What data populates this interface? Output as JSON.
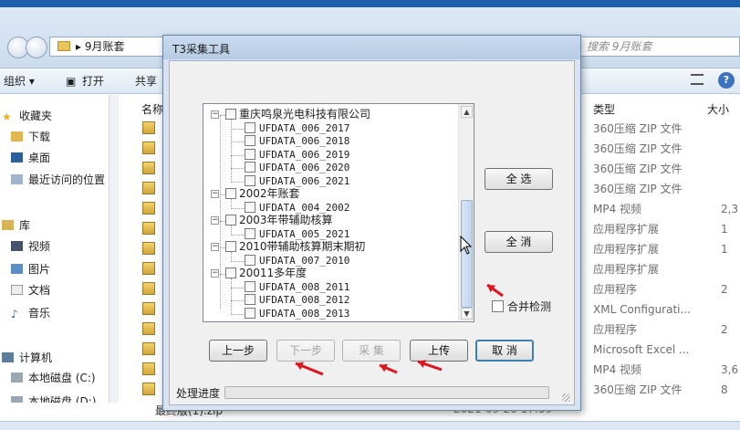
{
  "explorer": {
    "breadcrumb": "9月账套",
    "search_placeholder": "搜索 9月账套",
    "toolbar": {
      "organize": "组织 ▾",
      "open": "打开",
      "share": "共享"
    },
    "sidebar": [
      {
        "label": "收藏夹",
        "icon": "star-icon"
      },
      {
        "label": "下载",
        "icon": "download-folder-icon"
      },
      {
        "label": "桌面",
        "icon": "desktop-icon"
      },
      {
        "label": "最近访问的位置",
        "icon": "recent-places-icon"
      },
      {
        "label": "库",
        "icon": "library-icon"
      },
      {
        "label": "视频",
        "icon": "video-icon"
      },
      {
        "label": "图片",
        "icon": "pictures-icon"
      },
      {
        "label": "文档",
        "icon": "documents-icon"
      },
      {
        "label": "音乐",
        "icon": "music-icon"
      },
      {
        "label": "计算机",
        "icon": "computer-icon"
      },
      {
        "label": "本地磁盘 (C:)",
        "icon": "drive-icon"
      },
      {
        "label": "本地磁盘 (D:)",
        "icon": "drive-icon"
      }
    ],
    "columns": {
      "name": "名称",
      "type": "类型",
      "size": "大小"
    },
    "files": [
      {
        "type": "360压缩 ZIP 文件",
        "size": ""
      },
      {
        "type": "360压缩 ZIP 文件",
        "size": ""
      },
      {
        "type": "360压缩 ZIP 文件",
        "size": ""
      },
      {
        "type": "360压缩 ZIP 文件",
        "size": ""
      },
      {
        "type": "MP4 视频",
        "size": "2,3"
      },
      {
        "type": "应用程序扩展",
        "size": "1"
      },
      {
        "type": "应用程序扩展",
        "size": "1"
      },
      {
        "type": "应用程序扩展",
        "size": ""
      },
      {
        "type": "应用程序",
        "size": "2"
      },
      {
        "type": "XML Configurati...",
        "size": ""
      },
      {
        "type": "应用程序",
        "size": "2"
      },
      {
        "type": "Microsoft Excel ...",
        "size": ""
      },
      {
        "type": "MP4 视频",
        "size": "3,6"
      },
      {
        "type": "360压缩 ZIP 文件",
        "size": "8"
      },
      {
        "type": "360压缩 ZIP 文件",
        "size": ""
      }
    ],
    "bottom_file": "最终版(1).zip",
    "bottom_date": "2021-09-26 17:59"
  },
  "dialog": {
    "title": "T3采集工具",
    "tree": [
      {
        "label": "重庆鸣泉光电科技有限公司",
        "children": [
          "UFDATA_006_2017",
          "UFDATA_006_2018",
          "UFDATA_006_2019",
          "UFDATA_006_2020",
          "UFDATA_006_2021"
        ]
      },
      {
        "label": "2002年账套",
        "children": [
          "UFDATA_004_2002"
        ]
      },
      {
        "label": "2003年带辅助核算",
        "children": [
          "UFDATA_005_2021"
        ]
      },
      {
        "label": "2010带辅助核算期末期初",
        "children": [
          "UFDATA_007_2010"
        ]
      },
      {
        "label": "20011多年度",
        "children": [
          "UFDATA_008_2011",
          "UFDATA_008_2012",
          "UFDATA_008_2013"
        ]
      }
    ],
    "buttons": {
      "select_all": "全 选",
      "clear_all": "全 消",
      "prev": "上一步",
      "next": "下一步",
      "collect": "采 集",
      "upload": "上传",
      "cancel": "取 消"
    },
    "merge_check_label": "合并检测",
    "progress_label": "处理进度",
    "progress": 0
  },
  "annotation_color": "#e0141e"
}
